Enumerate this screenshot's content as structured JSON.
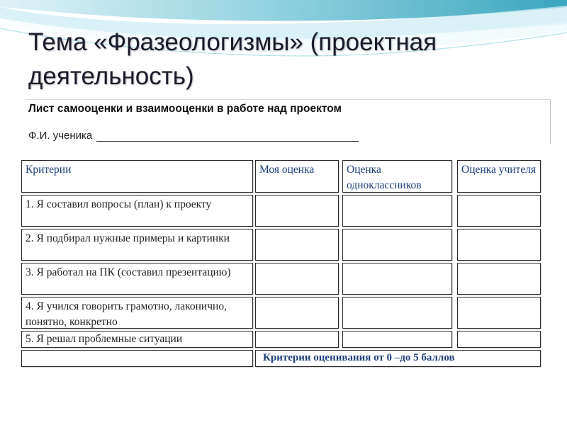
{
  "slide": {
    "title": "Тема «Фразеологизмы» (проектная деятельность)"
  },
  "sheet": {
    "title": "Лист самооценки и взаимооценки в работе над проектом",
    "student_label": "Ф.И. ученика"
  },
  "table": {
    "headers": [
      "Критерии",
      "Моя оценка",
      "Оценка одноклассников",
      "Оценка учителя"
    ],
    "criteria": [
      "1. Я составил вопросы (план) к проекту",
      "2. Я подбирал нужные  примеры и картинки",
      "3. Я работал на ПК (составил презентацию)",
      "4. Я учился говорить грамотно, лаконично, понятно, конкретно",
      "5. Я решал проблемные ситуации"
    ],
    "footer_note": "Критерии оценивания от 0 –до 5 баллов"
  },
  "colors": {
    "header_text": "#1f3f7a",
    "deco_teal": "#4fb3c8",
    "deco_light": "#bfe6ee"
  }
}
